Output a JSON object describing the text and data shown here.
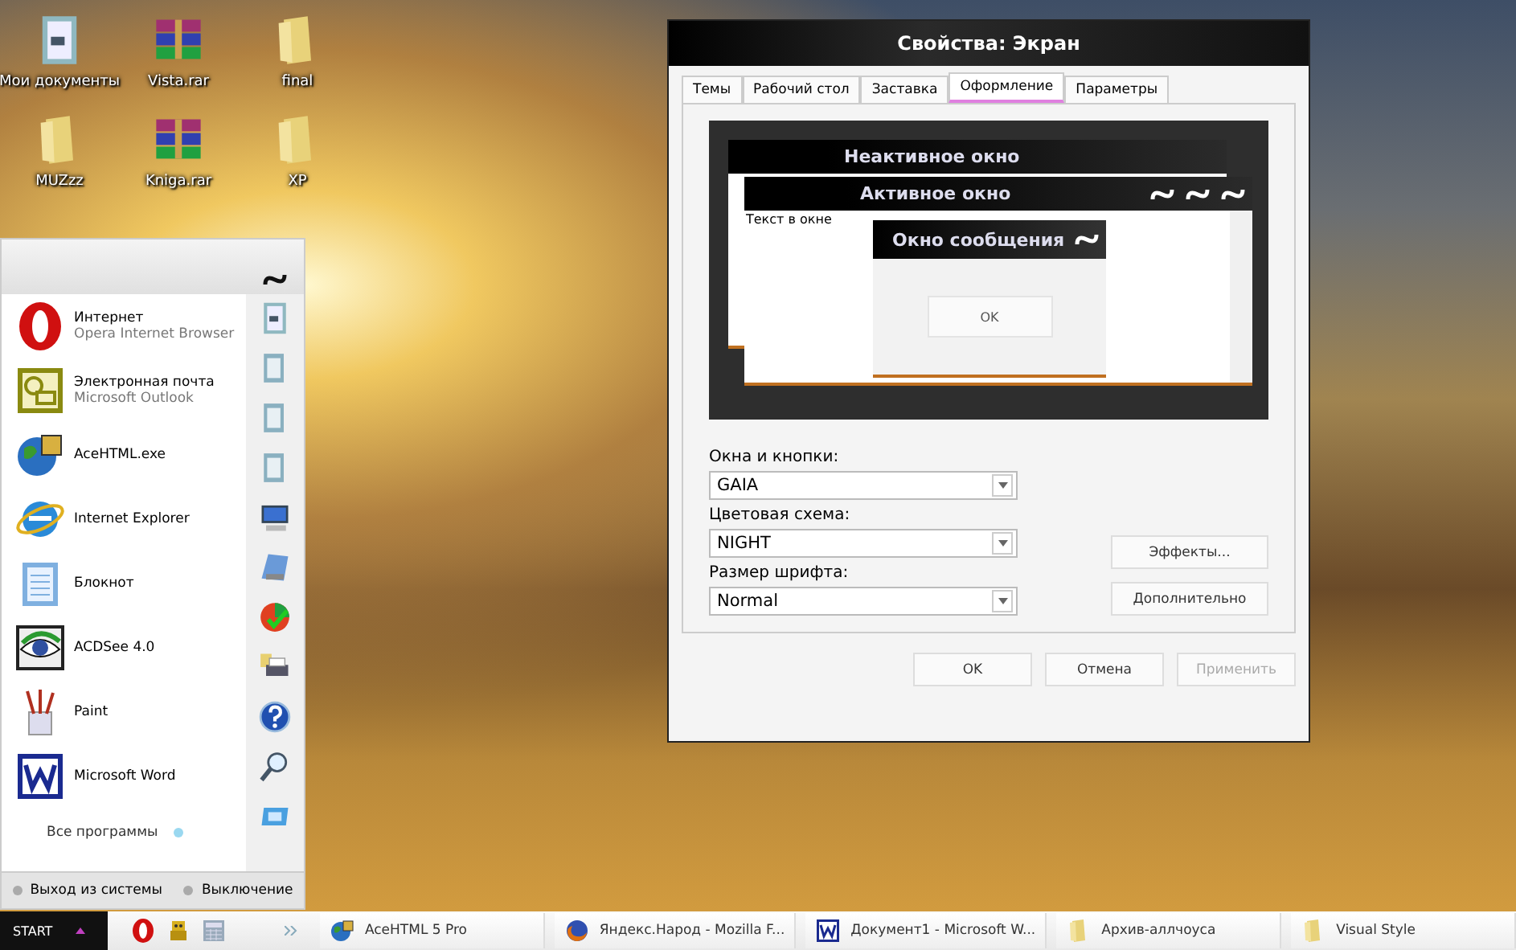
{
  "desktop_icons": [
    {
      "label": "Мои документы",
      "kind": "documents"
    },
    {
      "label": "Vista.rar",
      "kind": "archive"
    },
    {
      "label": "final",
      "kind": "folder"
    },
    {
      "label": "MUZzz",
      "kind": "folder"
    },
    {
      "label": "Kniga.rar",
      "kind": "archive"
    },
    {
      "label": "XP",
      "kind": "folder"
    }
  ],
  "start_menu": {
    "programs": [
      {
        "title": "Интернет",
        "subtitle": "Opera Internet Browser",
        "kind": "opera"
      },
      {
        "title": "Электронная почта",
        "subtitle": "Microsoft Outlook",
        "kind": "mail"
      },
      {
        "title": "AceHTML.exe",
        "kind": "globe"
      },
      {
        "title": "Internet Explorer",
        "kind": "ie"
      },
      {
        "title": "Блокнот",
        "kind": "notepad"
      },
      {
        "title": "ACDSee 4.0",
        "kind": "eye"
      },
      {
        "title": "Paint",
        "kind": "paint"
      },
      {
        "title": "Microsoft Word",
        "kind": "word"
      }
    ],
    "all_programs": "Все программы",
    "footer": [
      "Выход из системы",
      "Выключение"
    ]
  },
  "dialog": {
    "title": "Свойства: Экран",
    "tabs": [
      {
        "label": "Темы",
        "selected": false
      },
      {
        "label": "Рабочий стол",
        "selected": false
      },
      {
        "label": "Заставка",
        "selected": false
      },
      {
        "label": "Оформление",
        "selected": true
      },
      {
        "label": "Параметры",
        "selected": false
      }
    ],
    "preview": {
      "inactive_title": "Неактивное окно",
      "active_title": "Активное окно",
      "window_text": "Текст в окне",
      "message_title": "Окно сообщения",
      "message_button": "OK"
    },
    "fields": [
      {
        "label": "Окна и кнопки:",
        "value": "GAIA"
      },
      {
        "label": "Цветовая схема:",
        "value": "NIGHT"
      },
      {
        "label": "Размер шрифта:",
        "value": "Normal"
      }
    ],
    "side_buttons": [
      "Эффекты...",
      "Дополнительно"
    ],
    "buttons": [
      {
        "label": "OK",
        "disabled": false
      },
      {
        "label": "Отмена",
        "disabled": false
      },
      {
        "label": "Применить",
        "disabled": true
      }
    ]
  },
  "taskbar": {
    "start": "START",
    "tasks": [
      {
        "label": "AceHTML 5 Pro",
        "kind": "globe"
      },
      {
        "label": "Яндекс.Народ - Mozilla F...",
        "kind": "firefox"
      },
      {
        "label": "Документ1 - Microsoft W...",
        "kind": "word"
      },
      {
        "label": "Архив-аллчоуса",
        "kind": "folder"
      },
      {
        "label": "Visual Style",
        "kind": "folder"
      }
    ]
  }
}
